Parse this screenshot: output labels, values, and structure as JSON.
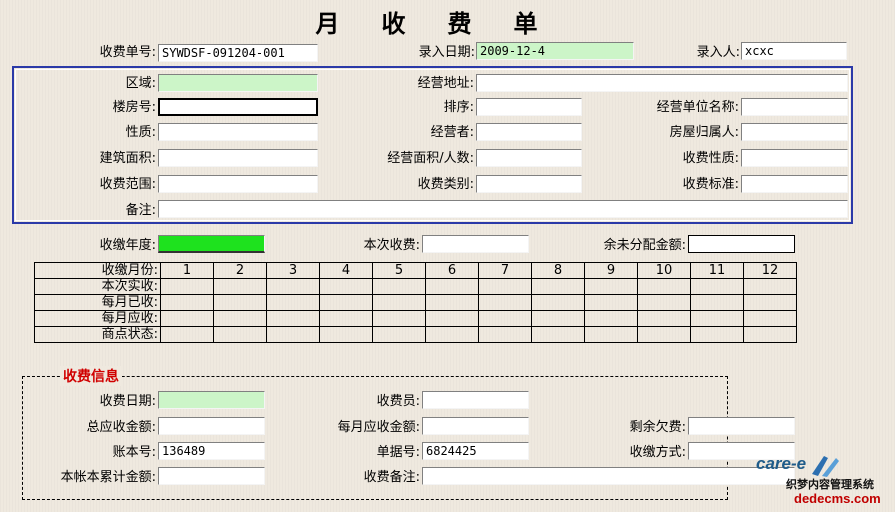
{
  "title": "月收费单",
  "header": {
    "receipt_no_label": "收费单号:",
    "receipt_no_value": "SYWDSF-091204-001",
    "entry_date_label": "录入日期:",
    "entry_date_value": "2009-12-4",
    "entry_person_label": "录入人:",
    "entry_person_value": "xcxc"
  },
  "property": {
    "area_label": "区域:",
    "address_label": "经营地址:",
    "building_label": "楼房号:",
    "order_label": "排序:",
    "unit_name_label": "经营单位名称:",
    "nature_label": "性质:",
    "operator_label": "经营者:",
    "owner_label": "房屋归属人:",
    "build_area_label": "建筑面积:",
    "biz_area_label": "经营面积/人数:",
    "fee_nature_label": "收费性质:",
    "fee_scope_label": "收费范围:",
    "fee_category_label": "收费类别:",
    "fee_standard_label": "收费标准:",
    "remark_label": "备注:"
  },
  "year_row": {
    "year_label": "收缴年度:",
    "current_fee_label": "本次收费:",
    "remaining_label": "余未分配金额:"
  },
  "month_table": {
    "header_label": "收缴月份:",
    "months": [
      "1",
      "2",
      "3",
      "4",
      "5",
      "6",
      "7",
      "8",
      "9",
      "10",
      "11",
      "12"
    ],
    "rows": [
      "本次实收:",
      "每月已收:",
      "每月应收:",
      "商点状态:"
    ]
  },
  "fee_info": {
    "legend": "收费信息",
    "fee_date_label": "收费日期:",
    "cashier_label": "收费员:",
    "total_due_label": "总应收金额:",
    "monthly_due_label": "每月应收金额:",
    "arrears_label": "剩余欠费:",
    "account_no_label": "账本号:",
    "account_no_value": "136489",
    "bill_no_label": "单据号:",
    "bill_no_value": "6824425",
    "pay_method_label": "收缴方式:",
    "book_total_label": "本帐本累计金额:",
    "fee_remark_label": "收费备注:"
  },
  "watermark": {
    "logo_text": "care-e",
    "site_cn": "织梦内容管理系统",
    "site_url": "dedecms.com"
  },
  "colors": {
    "box_border": "#2b3aa8",
    "legend_red": "#d00000",
    "light_green_field": "#ccf5c8",
    "bright_green_field": "#1ee21e"
  }
}
